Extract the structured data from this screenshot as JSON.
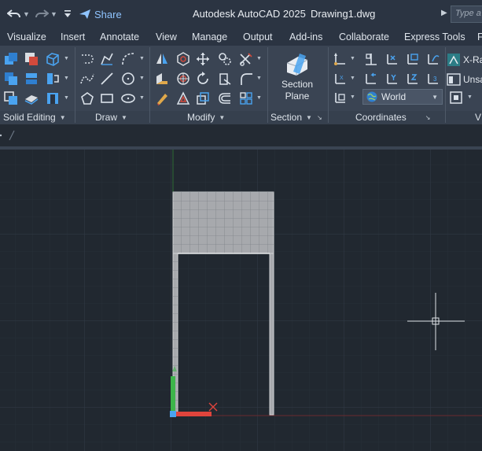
{
  "titlebar": {
    "share_label": "Share",
    "app_name": "Autodesk AutoCAD 2025",
    "file_name": "Drawing1.dwg",
    "search_placeholder": "Type a"
  },
  "tabs": [
    {
      "label": "Visualize"
    },
    {
      "label": "Insert"
    },
    {
      "label": "Annotate"
    },
    {
      "label": "View"
    },
    {
      "label": "Manage"
    },
    {
      "label": "Output"
    },
    {
      "label": "Add-ins"
    },
    {
      "label": "Collaborate"
    },
    {
      "label": "Express Tools"
    },
    {
      "label": "F"
    }
  ],
  "ribbon": {
    "groups": [
      {
        "label": "Solid Editing"
      },
      {
        "label": "Draw"
      },
      {
        "label": "Modify"
      },
      {
        "label": "Section"
      },
      {
        "label": "Coordinates"
      }
    ],
    "section_plane": {
      "line1": "Section",
      "line2": "Plane"
    },
    "ucs_value": "World",
    "xref_label": "X-Ra",
    "unsaved_label": "Unsa",
    "partial_group_label": "V"
  },
  "colors": {
    "accent": "#8fc4ff",
    "canvas": "#212830",
    "grid": "#2c3440",
    "y_axis": "#3db54a",
    "x_axis": "#e0443c"
  }
}
